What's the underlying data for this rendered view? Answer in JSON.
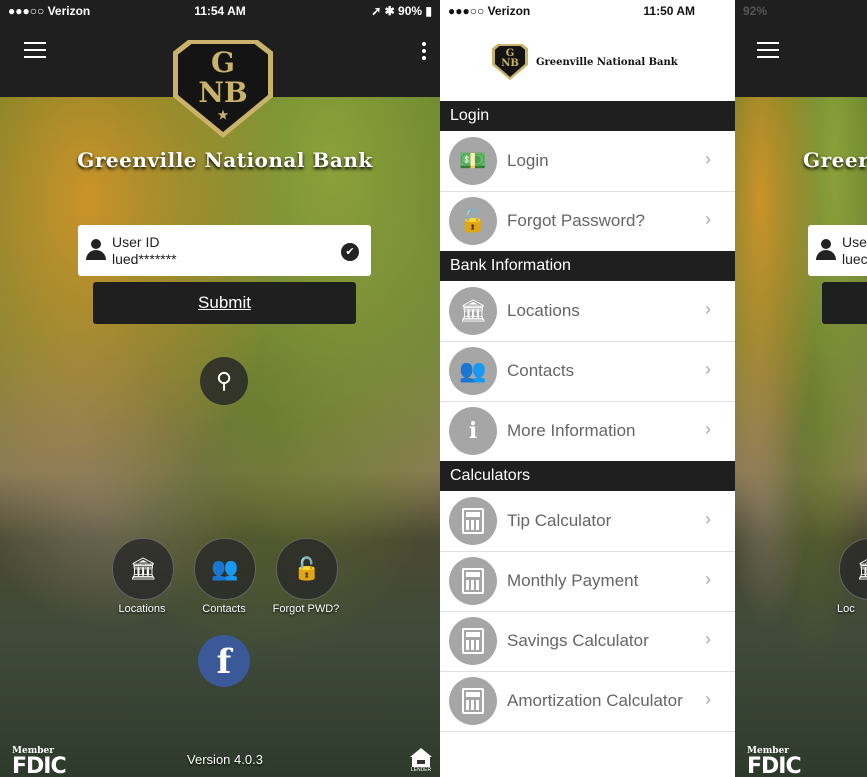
{
  "left_screen": {
    "status": {
      "carrier": "●●●○○ Verizon",
      "time": "11:54 AM",
      "battery": "90%"
    },
    "bank_name": "Greenville National Bank",
    "logo": {
      "line1": "G",
      "line2": "NB",
      "star": "★"
    },
    "user": {
      "label": "User ID",
      "value": "lued*******"
    },
    "submit_label": "Submit",
    "quick": [
      {
        "label": "Locations",
        "icon": "🏛"
      },
      {
        "label": "Contacts",
        "icon": "👥"
      },
      {
        "label": "Forgot PWD?",
        "icon": "🔓"
      }
    ],
    "facebook": "f",
    "fdic": {
      "member": "Member",
      "name": "FDIC"
    },
    "version": "Version 4.0.3",
    "housing_text": "LENDER"
  },
  "menu_screen": {
    "status": {
      "carrier": "●●●○○ Verizon",
      "time": "11:50 AM"
    },
    "logo": {
      "line1": "G",
      "line2": "NB"
    },
    "bank_name": "Greenville National Bank",
    "sections": [
      {
        "title": "Login",
        "items": [
          {
            "label": "Login",
            "icon": "💵"
          },
          {
            "label": "Forgot Password?",
            "icon": "🔓"
          }
        ]
      },
      {
        "title": "Bank Information",
        "items": [
          {
            "label": "Locations",
            "icon": "🏛"
          },
          {
            "label": "Contacts",
            "icon": "👥"
          },
          {
            "label": "More Information",
            "icon": "i"
          }
        ]
      },
      {
        "title": "Calculators",
        "items": [
          {
            "label": "Tip Calculator"
          },
          {
            "label": "Monthly Payment"
          },
          {
            "label": "Savings Calculator"
          },
          {
            "label": "Amortization Calculator"
          }
        ]
      }
    ],
    "chevron": "›"
  },
  "right_screen": {
    "status": {
      "battery": "92%"
    },
    "bank_name_partial": "Greer",
    "user_label_partial": "Use",
    "user_value_partial": "luec",
    "quick_label_partial": "Loc",
    "fdic": {
      "member": "Member",
      "name": "FDIC"
    }
  }
}
